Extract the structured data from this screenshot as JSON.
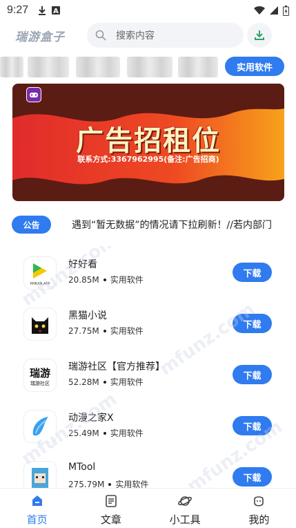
{
  "status_bar": {
    "time": "9:27"
  },
  "header": {
    "app_name": "瑞游盒子",
    "search_placeholder": "搜索内容"
  },
  "category": {
    "button_label": "实用软件"
  },
  "banner": {
    "title": "广告招租位",
    "subtitle": "联系方式:3367962995(备注:广告招商)"
  },
  "notice": {
    "badge": "公告",
    "text": "遇到“暂无数据”的情况请下拉刷新！//若内部门"
  },
  "apps": [
    {
      "name": "好好看",
      "size": "20.85M",
      "category": "实用软件",
      "download_label": "下载",
      "icon_text": "HHKAN.APP"
    },
    {
      "name": "黑猫小说",
      "size": "27.75M",
      "category": "实用软件",
      "download_label": "下载"
    },
    {
      "name": "瑞游社区【官方推荐】",
      "size": "52.28M",
      "category": "实用软件",
      "download_label": "下载",
      "icon_text": "瑞游",
      "icon_sub": "瑞游社区"
    },
    {
      "name": "动漫之家X",
      "size": "25.49M",
      "category": "实用软件",
      "download_label": "下载"
    },
    {
      "name": "MTool",
      "size": "275.79M",
      "category": "实用软件",
      "download_label": "下载"
    }
  ],
  "bottom_nav": [
    {
      "label": "首页",
      "icon": "home-icon",
      "active": true
    },
    {
      "label": "文章",
      "icon": "article-icon",
      "active": false
    },
    {
      "label": "小工具",
      "icon": "planet-icon",
      "active": false
    },
    {
      "label": "我的",
      "icon": "profile-icon",
      "active": false
    }
  ],
  "colors": {
    "accent": "#2f7bef",
    "banner_red": "#e0312a",
    "banner_bg": "#5b1c14"
  },
  "watermark": "mfunz.com"
}
